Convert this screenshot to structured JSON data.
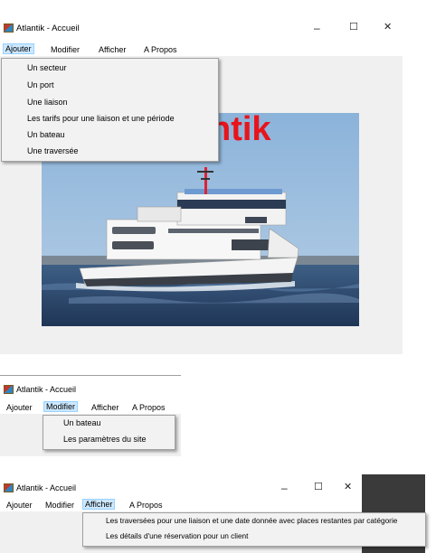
{
  "window1": {
    "title": "Atlantik - Accueil",
    "controls": {
      "minimize": "–",
      "maximize": "☐",
      "close": "✕"
    },
    "menu": [
      "Ajouter",
      "Modifier",
      "Afficher",
      "A Propos"
    ],
    "dropdown_items": [
      "Un secteur",
      "Un port",
      "Une liaison",
      "Les tarifs pour une liaison et une période",
      "Un bateau",
      "Une traversée"
    ],
    "banner_text": "ntik"
  },
  "window2": {
    "title": "Atlantik - Accueil",
    "menu": [
      "Ajouter",
      "Modifier",
      "Afficher",
      "A Propos"
    ],
    "dropdown_items": [
      "Un bateau",
      "Les paramètres du site"
    ]
  },
  "window3": {
    "title": "Atlantik - Accueil",
    "controls": {
      "minimize": "–",
      "maximize": "☐",
      "close": "✕"
    },
    "menu": [
      "Ajouter",
      "Modifier",
      "Afficher",
      "A Propos"
    ],
    "dropdown_items": [
      "Les traversées pour une liaison et une date donnée avec places restantes par catégorie",
      "Les détails d'une réservation pour un client"
    ]
  },
  "colors": {
    "banner_red": "#e8141b",
    "menu_highlight": "#cce8ff",
    "dropdown_bg": "#f2f2f2",
    "window_bg": "#f0f0f0"
  }
}
